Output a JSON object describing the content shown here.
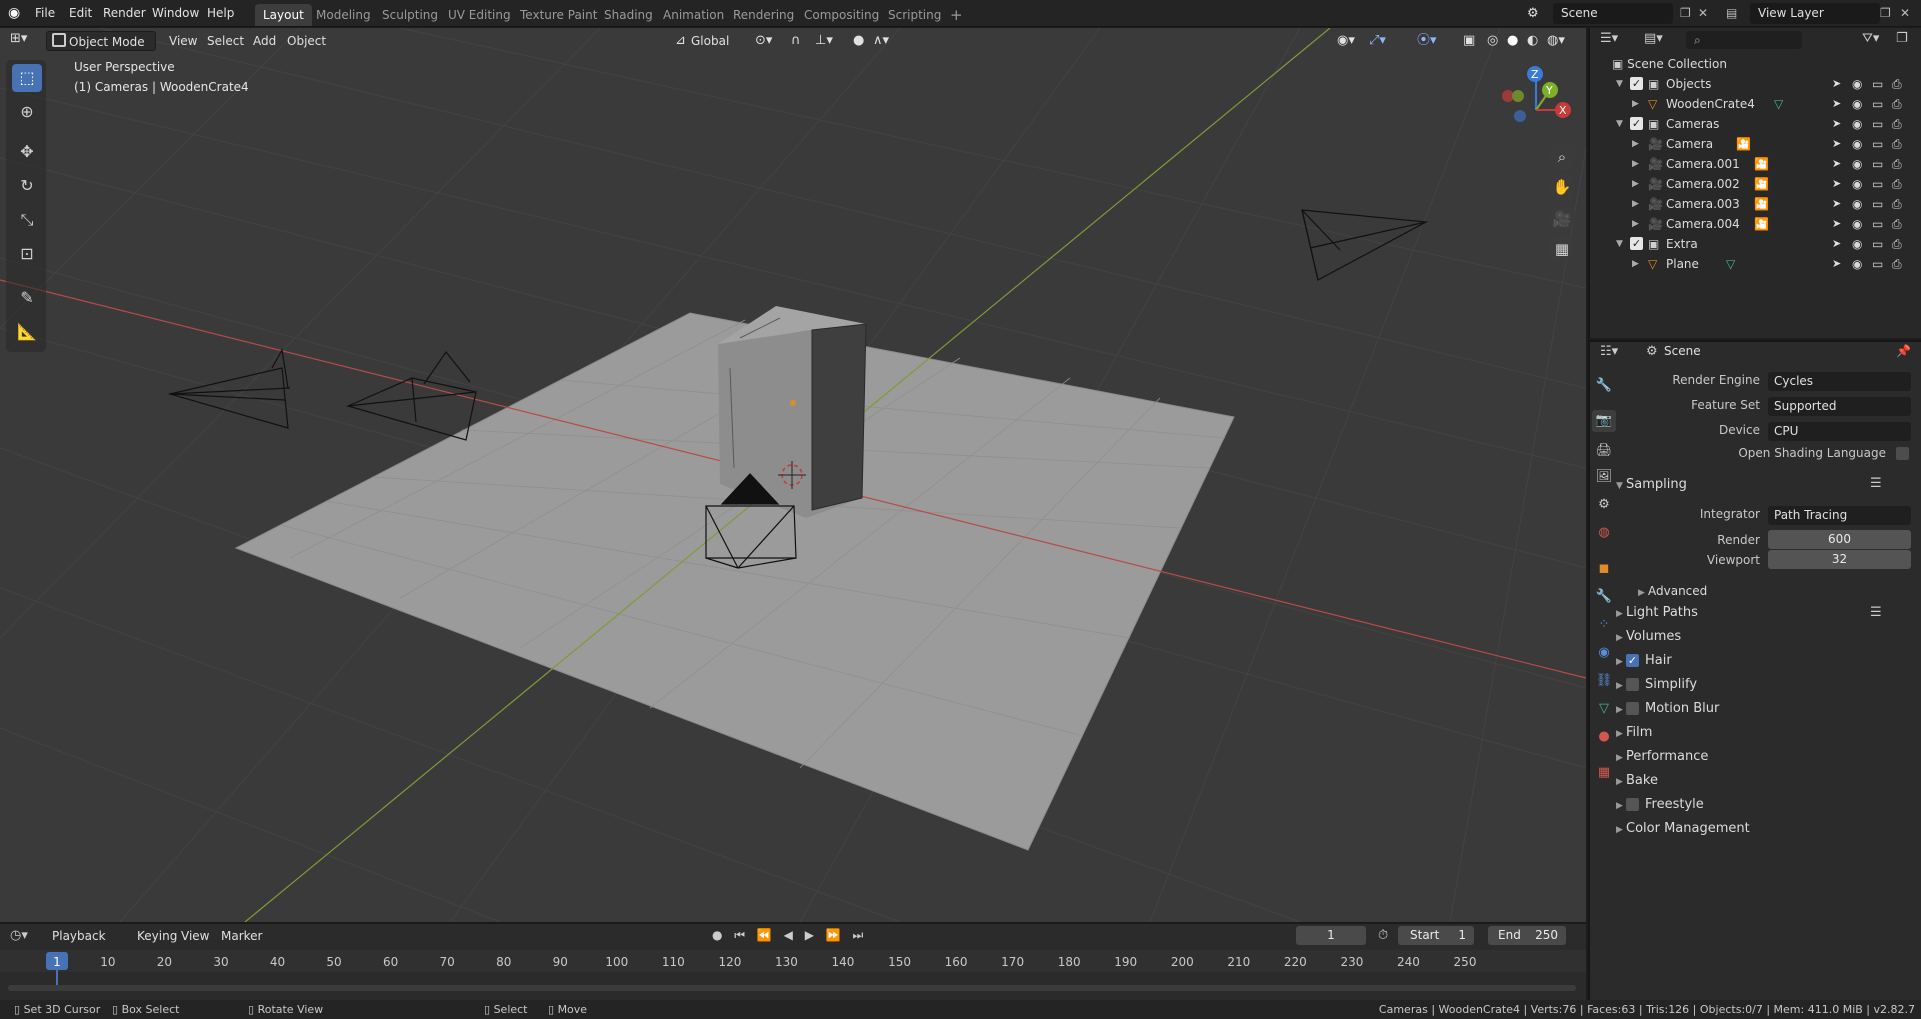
{
  "topbar": {
    "menus": [
      "File",
      "Edit",
      "Render",
      "Window",
      "Help"
    ],
    "workspaces": [
      "Layout",
      "Modeling",
      "Sculpting",
      "UV Editing",
      "Texture Paint",
      "Shading",
      "Animation",
      "Rendering",
      "Compositing",
      "Scripting"
    ],
    "add_tab": "+",
    "scene": "Scene",
    "view_layer": "View Layer"
  },
  "viewport": {
    "mode": "Object Mode",
    "menus": [
      "View",
      "Select",
      "Add",
      "Object"
    ],
    "orientation": "Global",
    "title": "User Perspective",
    "subtitle": "(1) Cameras | WoodenCrate4",
    "gizmo": {
      "z": "Z",
      "y": "Y",
      "x": "X"
    }
  },
  "outliner": {
    "search_placeholder": "",
    "root": "Scene Collection",
    "rows": [
      {
        "name": "Objects",
        "type": "collection"
      },
      {
        "name": "WoodenCrate4",
        "type": "mesh"
      },
      {
        "name": "Cameras",
        "type": "collection"
      },
      {
        "name": "Camera",
        "type": "camera"
      },
      {
        "name": "Camera.001",
        "type": "camera"
      },
      {
        "name": "Camera.002",
        "type": "camera"
      },
      {
        "name": "Camera.003",
        "type": "camera"
      },
      {
        "name": "Camera.004",
        "type": "camera"
      },
      {
        "name": "Extra",
        "type": "collection"
      },
      {
        "name": "Plane",
        "type": "mesh"
      }
    ]
  },
  "properties": {
    "context": "Scene",
    "render_engine_label": "Render Engine",
    "render_engine": "Cycles",
    "feature_set_label": "Feature Set",
    "feature_set": "Supported",
    "device_label": "Device",
    "device": "CPU",
    "osl_label": "Open Shading Language",
    "sampling": "Sampling",
    "integrator_label": "Integrator",
    "integrator": "Path Tracing",
    "render_label": "Render",
    "render_samples": "600",
    "viewport_label": "Viewport",
    "viewport_samples": "32",
    "advanced": "Advanced",
    "panels": [
      {
        "label": "Light Paths",
        "checkbox": null
      },
      {
        "label": "Volumes",
        "checkbox": null
      },
      {
        "label": "Hair",
        "checkbox": true
      },
      {
        "label": "Simplify",
        "checkbox": false
      },
      {
        "label": "Motion Blur",
        "checkbox": false
      },
      {
        "label": "Film",
        "checkbox": null
      },
      {
        "label": "Performance",
        "checkbox": null
      },
      {
        "label": "Bake",
        "checkbox": null
      },
      {
        "label": "Freestyle",
        "checkbox": false
      },
      {
        "label": "Color Management",
        "checkbox": null
      }
    ]
  },
  "timeline": {
    "menus": [
      "Playback",
      "Keying",
      "View",
      "Marker"
    ],
    "current_frame": "1",
    "start_label": "Start",
    "start": "1",
    "end_label": "End",
    "end": "250",
    "ticks": [
      "1",
      "10",
      "20",
      "30",
      "40",
      "50",
      "60",
      "70",
      "80",
      "90",
      "100",
      "110",
      "120",
      "130",
      "140",
      "150",
      "160",
      "170",
      "180",
      "190",
      "200",
      "210",
      "220",
      "230",
      "240",
      "250"
    ]
  },
  "statusbar": {
    "left": [
      "Set 3D Cursor",
      "Box Select",
      "Rotate View",
      "Select",
      "Move"
    ],
    "right": "Cameras | WoodenCrate4 | Verts:76 | Faces:63 | Tris:126 | Objects:0/7 | Mem: 411.0 MiB | v2.82.7"
  },
  "colors": {
    "accent": "#4772b3",
    "x_axis": "#c94848",
    "y_axis": "#8aa33a",
    "camera_icon": "#3fb58f",
    "mesh_icon": "#e0883a"
  }
}
